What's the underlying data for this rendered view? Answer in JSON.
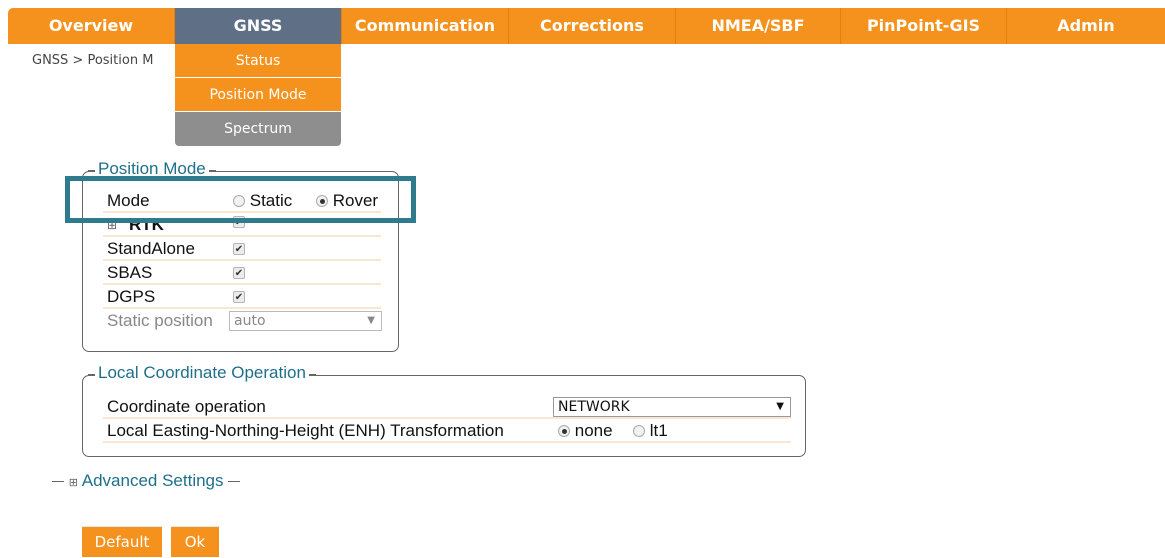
{
  "nav": {
    "tabs": [
      {
        "label": "Overview"
      },
      {
        "label": "GNSS"
      },
      {
        "label": "Communication"
      },
      {
        "label": "Corrections"
      },
      {
        "label": "NMEA/SBF"
      },
      {
        "label": "PinPoint-GIS"
      },
      {
        "label": "Admin"
      }
    ],
    "active_tab": "GNSS"
  },
  "breadcrumb": "GNSS > Position M",
  "dropdown": {
    "items": [
      {
        "label": "Status"
      },
      {
        "label": "Position Mode"
      },
      {
        "label": "Spectrum"
      }
    ]
  },
  "position_mode": {
    "legend": "Position Mode",
    "mode": {
      "label": "Mode",
      "options": [
        "Static",
        "Rover"
      ],
      "selected": "Rover"
    },
    "rtk": {
      "expand_glyph": "⊞",
      "label": "RTK",
      "checked": true
    },
    "standalone": {
      "label": "StandAlone",
      "checked": true
    },
    "sbas": {
      "label": "SBAS",
      "checked": true
    },
    "dgps": {
      "label": "DGPS",
      "checked": true
    },
    "static_position": {
      "label": "Static position",
      "value": "auto"
    }
  },
  "local_coordinate": {
    "legend": "Local Coordinate Operation",
    "coordinate_operation": {
      "label": "Coordinate operation",
      "value": "NETWORK"
    },
    "enh": {
      "label": "Local Easting-Northing-Height (ENH) Transformation",
      "options": [
        "none",
        "lt1"
      ],
      "selected": "none"
    }
  },
  "advanced": {
    "expand_glyph": "⊞",
    "label": "Advanced Settings"
  },
  "buttons": {
    "default": "Default",
    "ok": "Ok"
  },
  "colors": {
    "accent": "#f5921e",
    "active_tab": "#5f6f86",
    "legend_text": "#1f6f8b",
    "highlight": "#2d7b8c"
  }
}
